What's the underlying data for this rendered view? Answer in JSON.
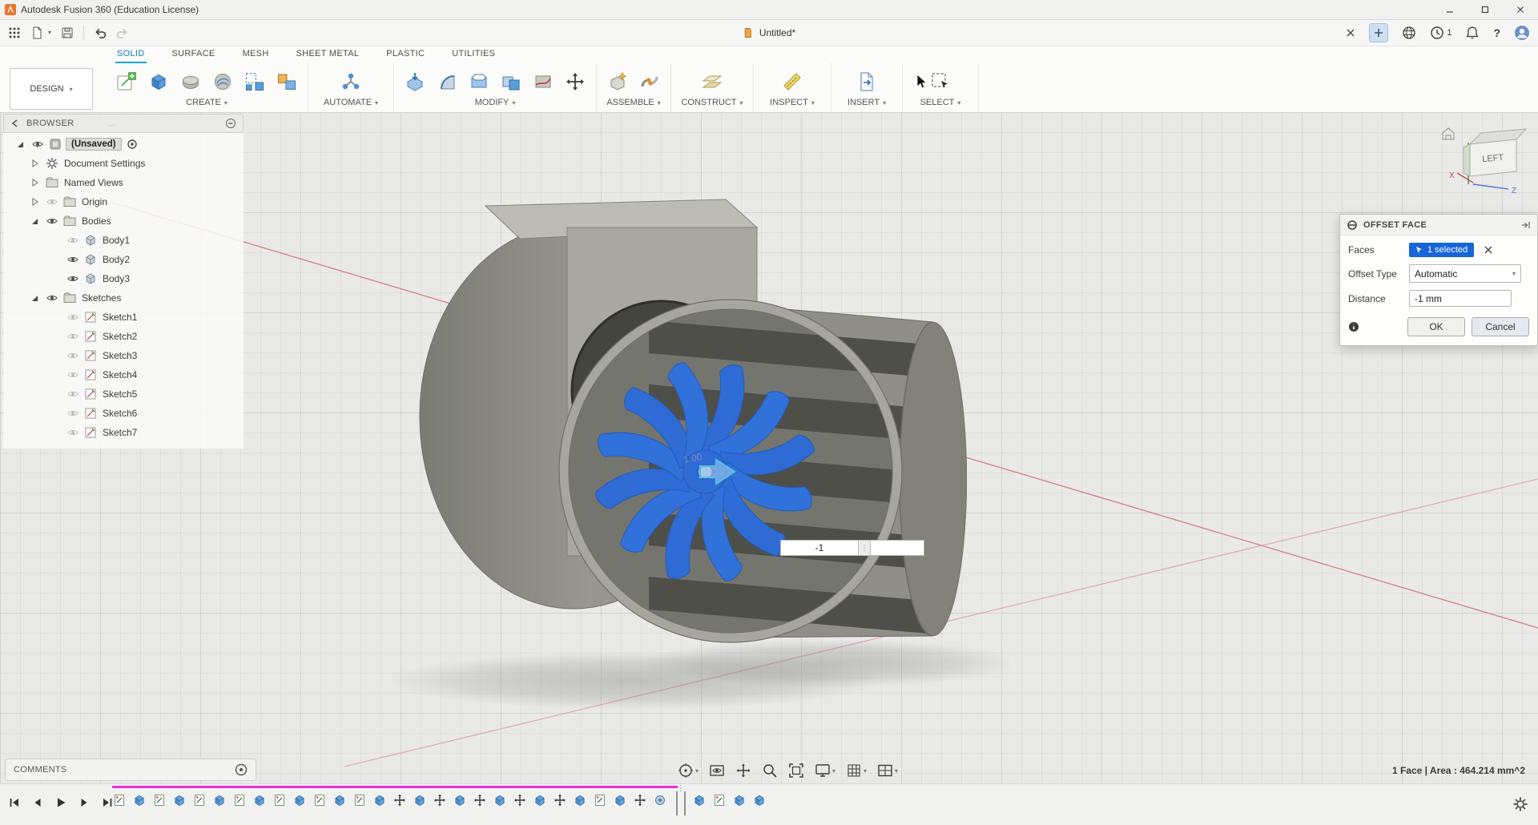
{
  "titlebar": {
    "app_title": "Autodesk Fusion 360 (Education License)"
  },
  "quick_access": {
    "document_tab": "Untitled*",
    "notification_count": "1",
    "help_label": "?"
  },
  "ribbon": {
    "workspace_selector": "DESIGN",
    "tabs": [
      {
        "label": "SOLID",
        "active": true
      },
      {
        "label": "SURFACE",
        "active": false
      },
      {
        "label": "MESH",
        "active": false
      },
      {
        "label": "SHEET METAL",
        "active": false
      },
      {
        "label": "PLASTIC",
        "active": false
      },
      {
        "label": "UTILITIES",
        "active": false
      }
    ],
    "groups": [
      {
        "label": "CREATE",
        "icons": [
          "create-sketch",
          "solid-box",
          "form-blob",
          "coil",
          "pattern",
          "derive"
        ]
      },
      {
        "label": "AUTOMATE",
        "icons": [
          "automate-net"
        ]
      },
      {
        "label": "MODIFY",
        "icons": [
          "press-pull",
          "fillet",
          "shell",
          "combine",
          "split",
          "move-arrows"
        ]
      },
      {
        "label": "ASSEMBLE",
        "icons": [
          "new-component",
          "joint"
        ]
      },
      {
        "label": "CONSTRUCT",
        "icons": [
          "construct-plane"
        ]
      },
      {
        "label": "INSPECT",
        "icons": [
          "measure"
        ]
      },
      {
        "label": "INSERT",
        "icons": [
          "insert-doc"
        ]
      },
      {
        "label": "SELECT",
        "icons": [
          "select-box"
        ]
      }
    ]
  },
  "browser": {
    "header": "BROWSER",
    "root_label": "(Unsaved)",
    "items": [
      {
        "label": "Document Settings",
        "icon": "gear",
        "expander": "closed",
        "eye": null,
        "level": 1
      },
      {
        "label": "Named Views",
        "icon": "folder",
        "expander": "closed",
        "eye": null,
        "level": 1
      },
      {
        "label": "Origin",
        "icon": "folder",
        "expander": "closed",
        "eye": "dim",
        "level": 1
      },
      {
        "label": "Bodies",
        "icon": "folder",
        "expander": "open",
        "eye": "on",
        "level": 1
      },
      {
        "label": "Body1",
        "icon": "body",
        "expander": null,
        "eye": "dim",
        "level": 2
      },
      {
        "label": "Body2",
        "icon": "body",
        "expander": null,
        "eye": "on",
        "level": 2
      },
      {
        "label": "Body3",
        "icon": "body",
        "expander": null,
        "eye": "on",
        "level": 2
      },
      {
        "label": "Sketches",
        "icon": "folder",
        "expander": "open",
        "eye": "on",
        "level": 1
      },
      {
        "label": "Sketch1",
        "icon": "sketch",
        "expander": null,
        "eye": "dim",
        "level": 2
      },
      {
        "label": "Sketch2",
        "icon": "sketch",
        "expander": null,
        "eye": "dim",
        "level": 2
      },
      {
        "label": "Sketch3",
        "icon": "sketch",
        "expander": null,
        "eye": "dim",
        "level": 2
      },
      {
        "label": "Sketch4",
        "icon": "sketch",
        "expander": null,
        "eye": "dim",
        "level": 2
      },
      {
        "label": "Sketch5",
        "icon": "sketch",
        "expander": null,
        "eye": "dim",
        "level": 2
      },
      {
        "label": "Sketch6",
        "icon": "sketch",
        "expander": null,
        "eye": "dim",
        "level": 2
      },
      {
        "label": "Sketch7",
        "icon": "sketch",
        "expander": null,
        "eye": "dim",
        "level": 2
      }
    ]
  },
  "viewport": {
    "viewcube_face": "LEFT",
    "axis_x": "X",
    "axis_z": "Z",
    "dimension_preview": "1.00",
    "inline_input_value": "-1",
    "inline_input_secondary": ""
  },
  "offset_dialog": {
    "title": "OFFSET FACE",
    "faces_label": "Faces",
    "faces_value": "1 selected",
    "offset_type_label": "Offset Type",
    "offset_type_value": "Automatic",
    "distance_label": "Distance",
    "distance_value": "-1 mm",
    "ok_label": "OK",
    "cancel_label": "Cancel"
  },
  "statusbar": {
    "comments_label": "COMMENTS",
    "selection_info": "1 Face | Area : 464.214 mm^2"
  },
  "timeline": {
    "playback": [
      "skip-start",
      "step-back",
      "play",
      "step-forward",
      "skip-end"
    ],
    "markers_before_scrubber": [
      "sketch",
      "extrude",
      "sketch",
      "extrude",
      "sketch",
      "extrude",
      "sketch",
      "extrude",
      "sketch",
      "extrude",
      "sketch",
      "extrude",
      "sketch",
      "extrude",
      "move",
      "extrude",
      "move",
      "extrude",
      "move",
      "extrude",
      "move",
      "extrude",
      "move",
      "extrude",
      "sketch",
      "extrude",
      "move",
      "revolve"
    ],
    "markers_after_scrubber": [
      "extrude",
      "sketch",
      "extrude",
      "extrude"
    ]
  },
  "nav_toolbar": [
    {
      "icon": "orbit",
      "caret": true
    },
    {
      "icon": "look-at",
      "caret": false
    },
    {
      "icon": "pan",
      "caret": false
    },
    {
      "icon": "zoom",
      "caret": false
    },
    {
      "icon": "fit",
      "caret": false
    },
    {
      "icon": "display-settings",
      "caret": true
    },
    {
      "icon": "grid-snaps",
      "caret": true
    },
    {
      "icon": "viewports",
      "caret": true
    }
  ],
  "colors": {
    "accent_blue": "#12a5dc",
    "selection_blue": "#1766d8",
    "impeller_blue": "#2e6bd4",
    "timeline_magenta": "#ee2ed8"
  }
}
